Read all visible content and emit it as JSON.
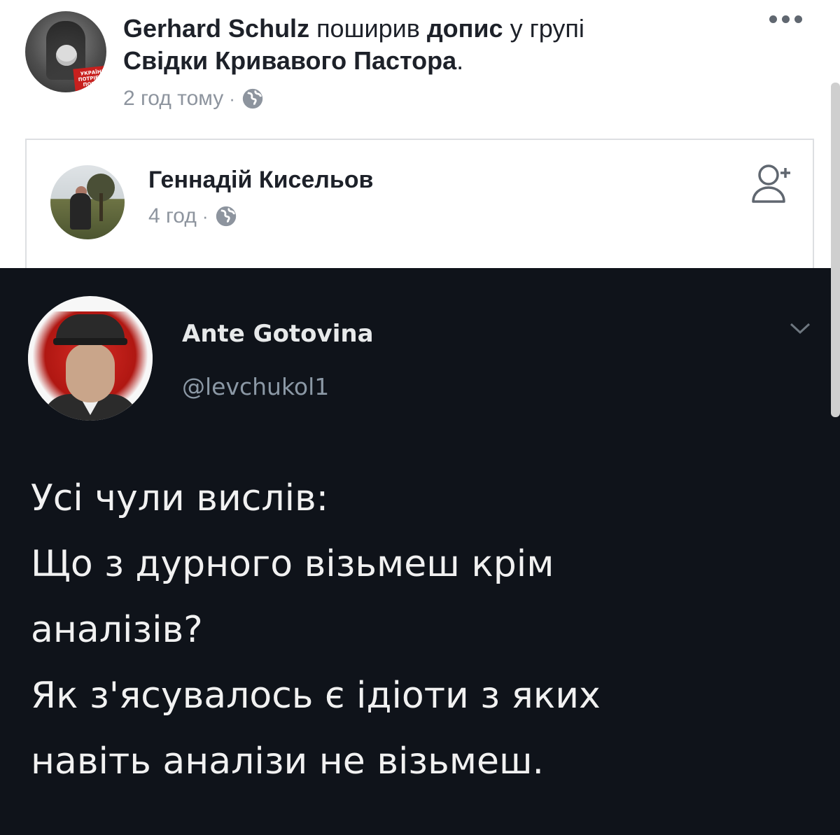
{
  "share": {
    "sharer_name": "Gerhard Schulz",
    "action_text": " поширив ",
    "object_text": "допис",
    "group_prefix": " у групі ",
    "group_name": "Свідки Кривавого Пастора",
    "group_suffix": ".",
    "time": "2 год тому",
    "separator": "·",
    "privacy_icon": "globe-icon",
    "avatar_badge_text": "УКРАЇНІ ПОТРІБЕН ПОРОХ",
    "more_icon": "more-options-icon"
  },
  "original_post": {
    "author_name": "Геннадій Кисельов",
    "time": "4 год",
    "separator": "·",
    "privacy_icon": "globe-icon",
    "add_friend_icon": "add-friend-icon"
  },
  "tweet": {
    "display_name": "Ante Gotovina",
    "handle": "@levchukol1",
    "menu_icon": "chevron-down-icon",
    "lines": [
      "Усі чули вислів:",
      "Що з дурного візьмеш крім",
      "аналізів?",
      "Як з'ясувалось є ідіоти з яких",
      "навіть аналізи не візьмеш."
    ]
  },
  "colors": {
    "text_primary": "#1d2129",
    "text_meta": "#8d949e",
    "tweet_bg": "#0f131a",
    "tweet_text": "#f1f1f1",
    "tweet_handle": "#8b98a5",
    "card_border": "#dddfe2"
  }
}
